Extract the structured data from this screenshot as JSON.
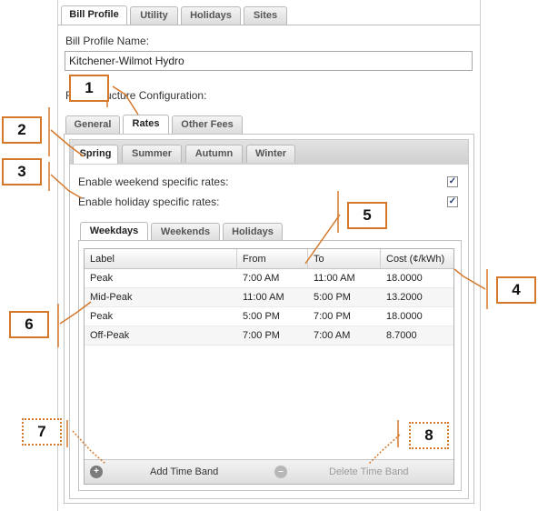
{
  "top_tabs": [
    "Bill Profile",
    "Utility",
    "Holidays",
    "Sites"
  ],
  "profile_name_label": "Bill Profile Name:",
  "profile_name_value": "Kitchener-Wilmot Hydro",
  "rate_structure_label": "Rate Structure Configuration:",
  "config_tabs": [
    "General",
    "Rates",
    "Other Fees"
  ],
  "season_tabs": [
    "Spring",
    "Summer",
    "Autumn",
    "Winter"
  ],
  "options": {
    "weekend_label": "Enable weekend specific rates:",
    "weekend_checked": true,
    "holiday_label": "Enable holiday specific rates:",
    "holiday_checked": true
  },
  "day_tabs": [
    "Weekdays",
    "Weekends",
    "Holidays"
  ],
  "grid": {
    "columns": [
      "Label",
      "From",
      "To",
      "Cost (¢/kWh)"
    ],
    "rows": [
      [
        "Peak",
        "7:00 AM",
        "11:00 AM",
        "18.0000"
      ],
      [
        "Mid-Peak",
        "11:00 AM",
        "5:00 PM",
        "13.2000"
      ],
      [
        "Peak",
        "5:00 PM",
        "7:00 PM",
        "18.0000"
      ],
      [
        "Off-Peak",
        "7:00 PM",
        "7:00 AM",
        "8.7000"
      ]
    ],
    "add_label": "Add Time Band",
    "delete_label": "Delete Time Band"
  },
  "callouts": [
    "1",
    "2",
    "3",
    "4",
    "5",
    "6",
    "7",
    "8"
  ],
  "colors": {
    "callout": "#d5782a",
    "check": "#1d3d78"
  }
}
